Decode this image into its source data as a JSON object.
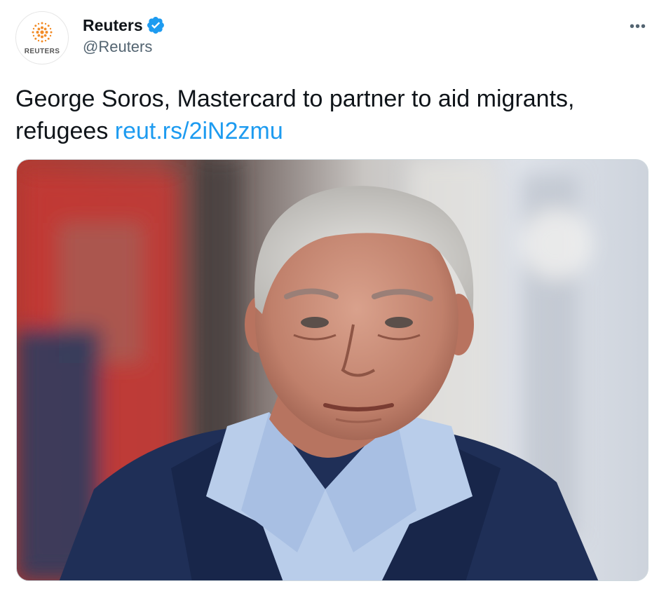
{
  "account": {
    "display_name": "Reuters",
    "handle": "@Reuters",
    "avatar_text": "REUTERS",
    "verified": true,
    "verified_color": "#1d9bf0"
  },
  "tweet": {
    "text": "George Soros, Mastercard to partner to aid migrants, refugees ",
    "link": "reut.rs/2iN2zmu"
  },
  "menu": {
    "more_label": "•••"
  },
  "icons": {
    "avatar": "reuters-logo-icon",
    "verified": "verified-badge-icon",
    "more": "more-icon"
  },
  "colors": {
    "text": "#0f1419",
    "secondary": "#536471",
    "link": "#1d9bf0",
    "reuters_orange": "#f28c28"
  }
}
